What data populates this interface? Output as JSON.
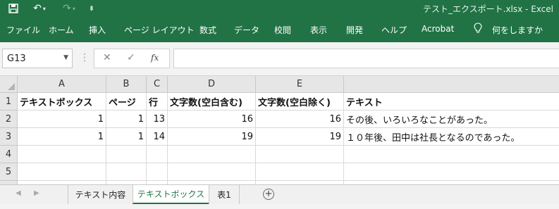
{
  "title_bar": {
    "title": "テスト_エクスポート.xlsx  -  Excel",
    "save_icon": "save-icon",
    "undo_icon": "undo-icon",
    "redo_icon": "redo-icon",
    "customize_icon": "customize-qat-icon"
  },
  "ribbon": {
    "tabs": [
      "ファイル",
      "ホーム",
      "挿入",
      "ページ レイアウト",
      "数式",
      "データ",
      "校閲",
      "表示",
      "開発",
      "ヘルプ",
      "Acrobat"
    ],
    "tell_me": "何をしますか",
    "tell_me_icon": "lightbulb-icon"
  },
  "formula_bar": {
    "name_box": "G13",
    "cancel_icon": "✕",
    "enter_icon": "✓",
    "function_icon": "fx",
    "value": ""
  },
  "grid": {
    "columns": [
      "A",
      "B",
      "C",
      "D",
      "E"
    ],
    "rows": [
      "1",
      "2",
      "3",
      "4",
      "5"
    ],
    "header_row": [
      "テキストボックス",
      "ページ",
      "行",
      "文字数(空白含む)",
      "文字数(空白除く)",
      "テキスト"
    ],
    "data_rows": [
      [
        "1",
        "1",
        "13",
        "16",
        "16",
        "その後、いろいろなことがあった。"
      ],
      [
        "1",
        "1",
        "14",
        "19",
        "19",
        "１０年後、田中は社長となるのであった。"
      ]
    ]
  },
  "sheets": {
    "tabs": [
      "テキスト内容",
      "テキストボックス",
      "表1"
    ],
    "active": "テキストボックス",
    "add_label": "+"
  },
  "colors": {
    "excel_green": "#217346",
    "header_gray": "#e6e6e6",
    "gridline": "#d9d9d9"
  }
}
